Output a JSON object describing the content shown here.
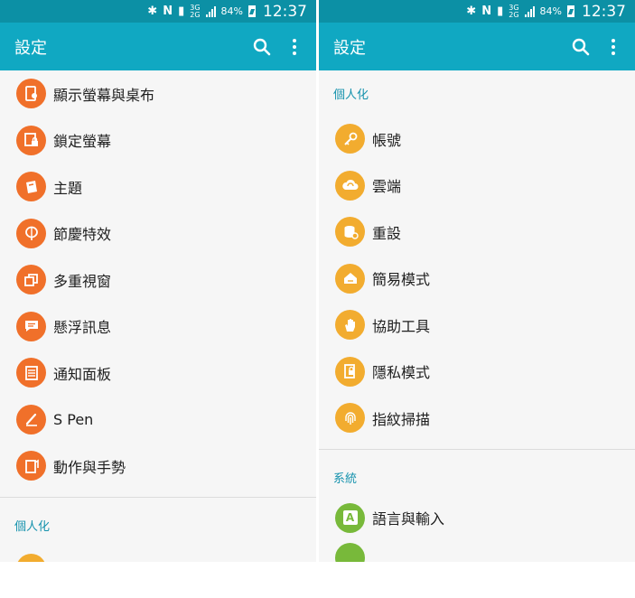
{
  "status": {
    "network_top": "3G",
    "network_bottom": "2G",
    "battery": "84%",
    "time": "12:37"
  },
  "left": {
    "title": "設定",
    "items": [
      {
        "label": "顯示螢幕與桌布",
        "icon": "display-wallpaper-icon"
      },
      {
        "label": "鎖定螢幕",
        "icon": "lock-screen-icon"
      },
      {
        "label": "主題",
        "icon": "theme-icon"
      },
      {
        "label": "節慶特效",
        "icon": "lantern-icon"
      },
      {
        "label": "多重視窗",
        "icon": "multi-window-icon"
      },
      {
        "label": "懸浮訊息",
        "icon": "floating-message-icon"
      },
      {
        "label": "通知面板",
        "icon": "notification-panel-icon"
      },
      {
        "label": "S Pen",
        "icon": "s-pen-icon"
      },
      {
        "label": "動作與手勢",
        "icon": "motion-gesture-icon"
      }
    ],
    "section": "個人化"
  },
  "right": {
    "title": "設定",
    "section_personal": "個人化",
    "items": [
      {
        "label": "帳號",
        "icon": "key-icon"
      },
      {
        "label": "雲端",
        "icon": "cloud-icon"
      },
      {
        "label": "重設",
        "icon": "reset-icon"
      },
      {
        "label": "簡易模式",
        "icon": "easy-mode-icon"
      },
      {
        "label": "協助工具",
        "icon": "hand-icon"
      },
      {
        "label": "隱私模式",
        "icon": "private-mode-icon"
      },
      {
        "label": "指紋掃描",
        "icon": "fingerprint-icon"
      }
    ],
    "section_system": "系統",
    "system_items": [
      {
        "label": "語言與輸入",
        "icon": "language-input-icon",
        "glyph": "A"
      }
    ]
  },
  "colors": {
    "statusbar": "#0c90a5",
    "appbar": "#10a8c2",
    "icon_orange": "#f0702a",
    "icon_yellow": "#f2ac2f",
    "icon_green": "#78b93a",
    "section_text": "#1592ad"
  }
}
